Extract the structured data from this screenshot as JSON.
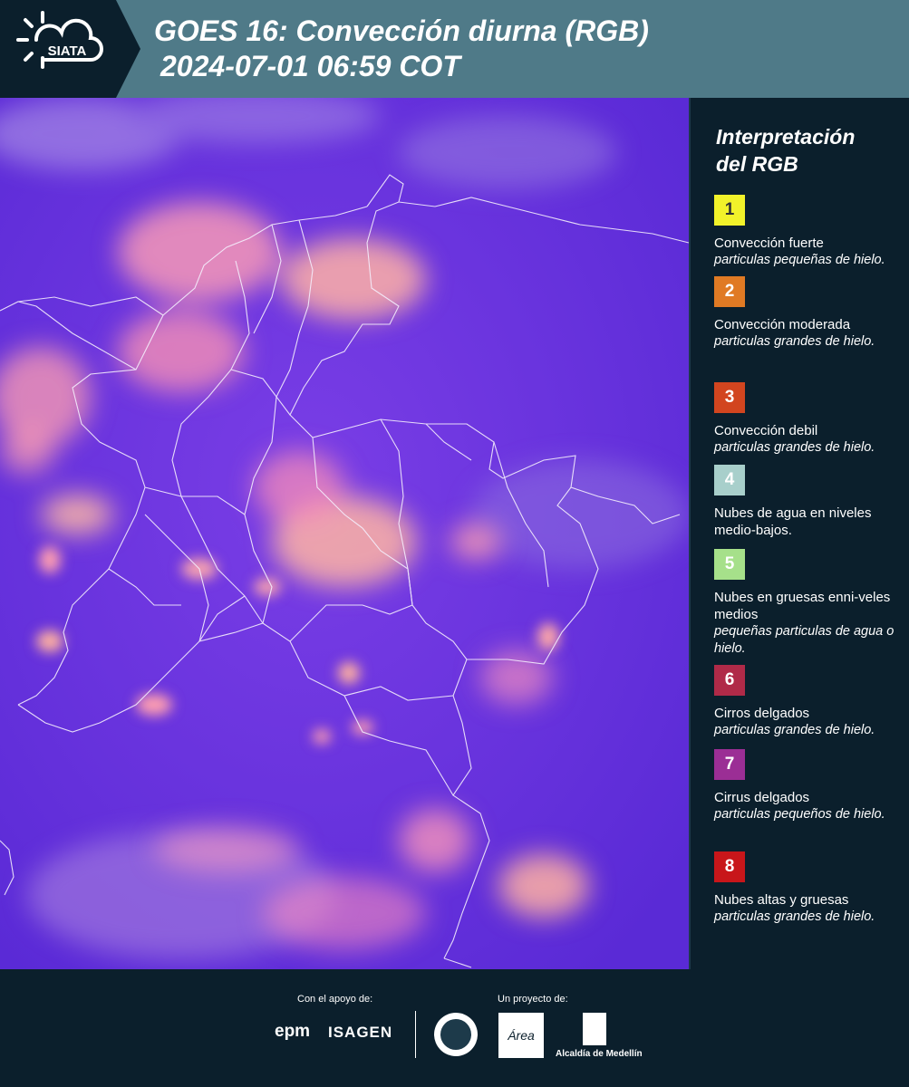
{
  "header": {
    "logo_text": "SIATA",
    "title_line1": "GOES 16: Convección diurna (RGB)",
    "title_line2": "2024-07-01 06:59 COT",
    "background": "#4f7a88"
  },
  "legend": {
    "title_line1": "Interpretación",
    "title_line2": "del RGB",
    "items": [
      {
        "number": "1",
        "color": "#f2f22a",
        "text_color": "#333333",
        "label": "Convección fuerte",
        "sub": "particulas pequeñas de hielo."
      },
      {
        "number": "2",
        "color": "#e07a24",
        "text_color": "#ffffff",
        "label": "Convección moderada",
        "sub": "particulas grandes de hielo."
      },
      {
        "number": "3",
        "color": "#d2451f",
        "text_color": "#ffffff",
        "label": "Convección debil",
        "sub": "particulas grandes de hielo."
      },
      {
        "number": "4",
        "color": "#a8cfcb",
        "text_color": "#ffffff",
        "label": "Nubes de agua en niveles medio-bajos.",
        "sub": ""
      },
      {
        "number": "5",
        "color": "#a6e08a",
        "text_color": "#ffffff",
        "label": "Nubes en gruesas enni-veles medios",
        "sub": "pequeñas particulas de agua o hielo."
      },
      {
        "number": "6",
        "color": "#b02a48",
        "text_color": "#ffffff",
        "label": "Cirros delgados",
        "sub": "particulas grandes de hielo."
      },
      {
        "number": "7",
        "color": "#9b2e95",
        "text_color": "#ffffff",
        "label": "Cirrus delgados",
        "sub": "particulas pequeños de hielo."
      },
      {
        "number": "8",
        "color": "#c8161a",
        "text_color": "#ffffff",
        "label": "Nubes altas y gruesas",
        "sub": "particulas grandes de hielo."
      }
    ]
  },
  "footer": {
    "support_label": "Con el apoyo de:",
    "project_label": "Un proyecto de:",
    "support_logos": [
      "epm",
      "ISAGEN"
    ],
    "project_logos": [
      "Área Metropolitana",
      "Alcaldía de Medellín"
    ],
    "epm_text": "epm",
    "isagen_text": "ISAGEN",
    "area_text": "Área",
    "alcaldia_text": "Alcaldía de Medellín"
  },
  "map": {
    "background_color": "#6a2fe0",
    "cloud_color": "#ffb3a6"
  }
}
